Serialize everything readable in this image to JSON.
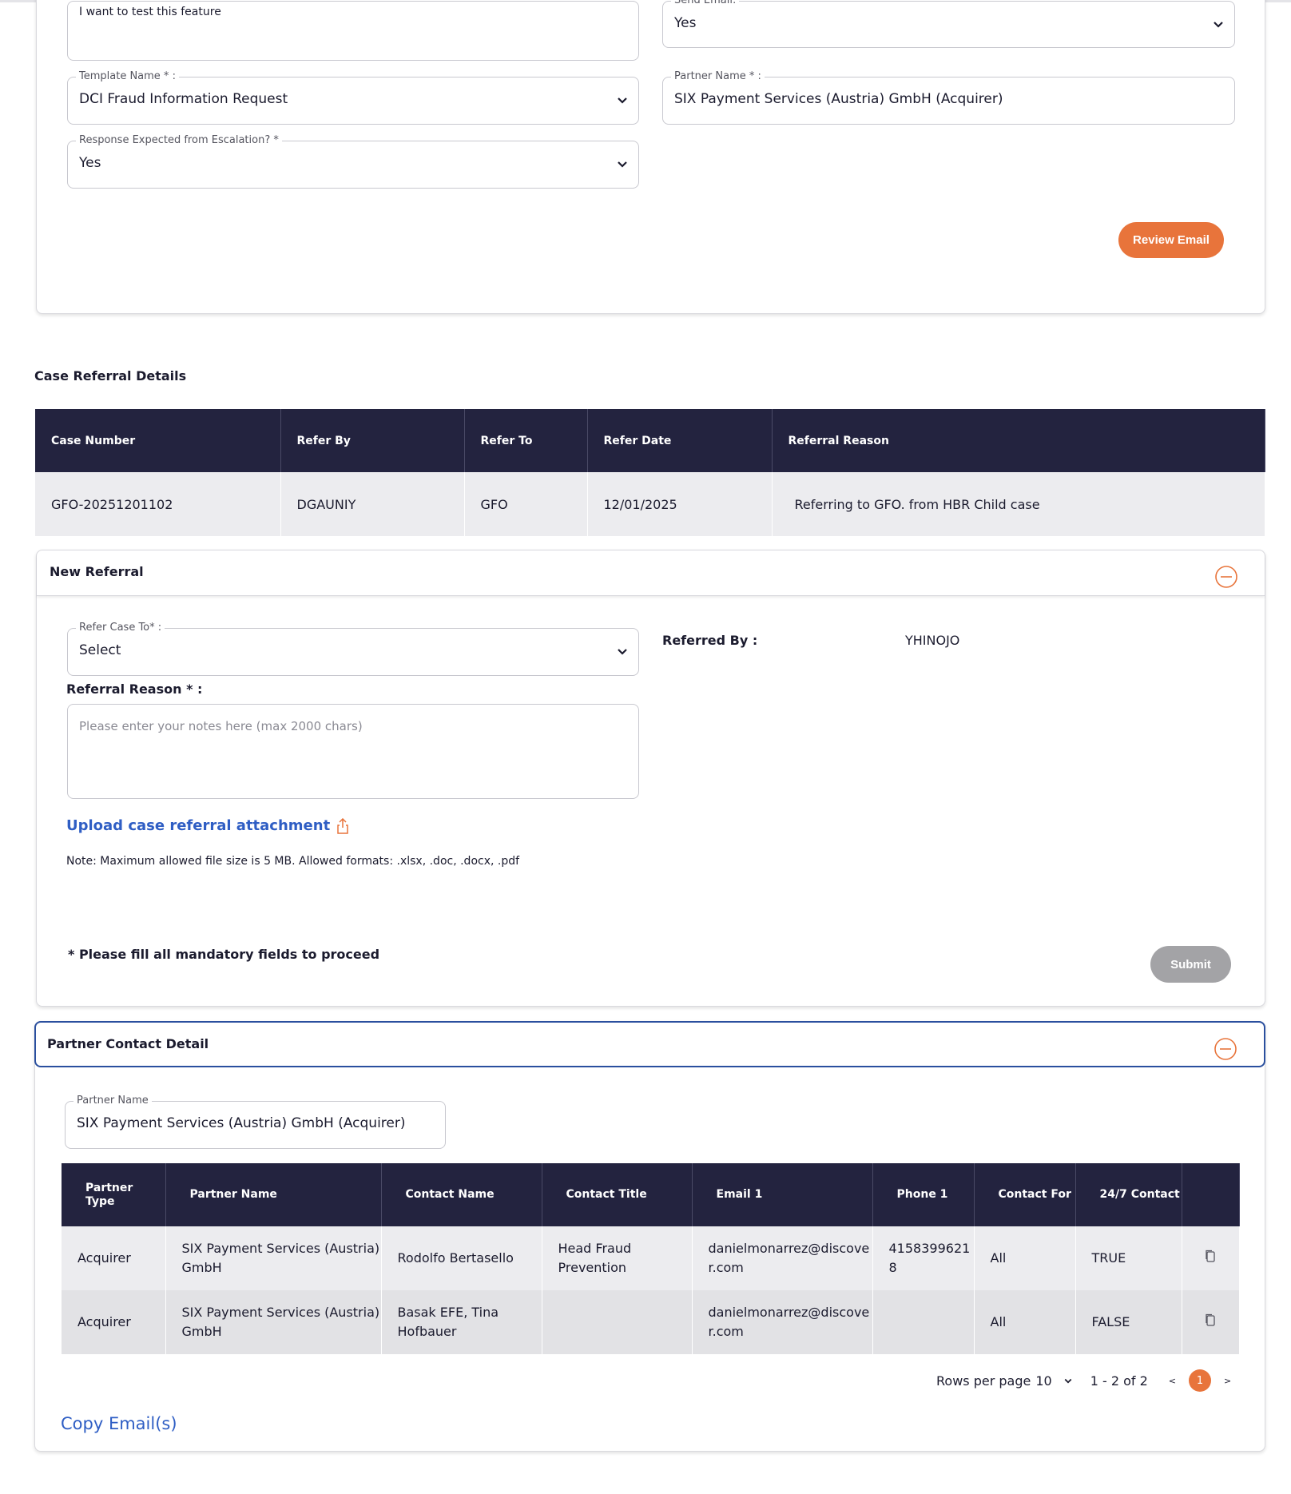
{
  "escalation": {
    "notes_value": "I want to test this feature",
    "send_email_label": "Send Email:",
    "send_email_value": "Yes",
    "template_name_label": "Template Name * :",
    "template_name_value": "DCI Fraud Information Request",
    "partner_name_label": "Partner Name * :",
    "partner_name_value": "SIX Payment Services (Austria) GmbH (Acquirer)",
    "response_expected_label": "Response Expected from Escalation? *",
    "response_expected_value": "Yes",
    "review_email_button": "Review Email"
  },
  "case_referral_details": {
    "title": "Case Referral Details",
    "columns": [
      "Case Number",
      "Refer By",
      "Refer To",
      "Refer Date",
      "Referral Reason"
    ],
    "rows": [
      [
        "GFO-20251201102",
        "DGAUNIY",
        "GFO",
        "12/01/2025",
        "Referring to GFO. from HBR Child case"
      ]
    ]
  },
  "new_referral": {
    "title": "New Referral",
    "refer_case_to_label": "Refer Case To* :",
    "refer_case_to_value": "Select",
    "referred_by_label": "Referred By :",
    "referred_by_value": "YHINOJO",
    "referral_reason_label": "Referral Reason * :",
    "referral_reason_placeholder": "Please enter your notes here (max 2000 chars)",
    "upload_link": "Upload case referral attachment",
    "file_note": "Note: Maximum allowed file size is 5 MB. Allowed formats: .xlsx, .doc, .docx, .pdf",
    "mandatory_note": "* Please fill all mandatory fields to proceed",
    "submit_button": "Submit"
  },
  "partner_contact": {
    "title": "Partner Contact Detail",
    "partner_name_label": "Partner Name",
    "partner_name_value": "SIX Payment Services (Austria) GmbH (Acquirer)",
    "columns": [
      "Partner Type",
      "Partner Name",
      "Contact Name",
      "Contact Title",
      "Email 1",
      "Phone 1",
      "Contact For",
      "24/7 Contact",
      ""
    ],
    "rows": [
      [
        "Acquirer",
        "SIX Payment Services (Austria) GmbH",
        "Rodolfo Bertasello",
        "Head Fraud Prevention",
        "danielmonarrez@discover.com",
        "41583996218",
        "All",
        "TRUE"
      ],
      [
        "Acquirer",
        "SIX Payment Services (Austria) GmbH",
        "Basak EFE, Tina Hofbauer",
        "",
        "danielmonarrez@discover.com",
        "",
        "All",
        "FALSE"
      ]
    ],
    "rows_per_page_label": "Rows per page",
    "rows_per_page_value": "10",
    "range_text": "1 - 2 of 2",
    "current_page": "1",
    "copy_emails_link": "Copy Email(s)"
  }
}
